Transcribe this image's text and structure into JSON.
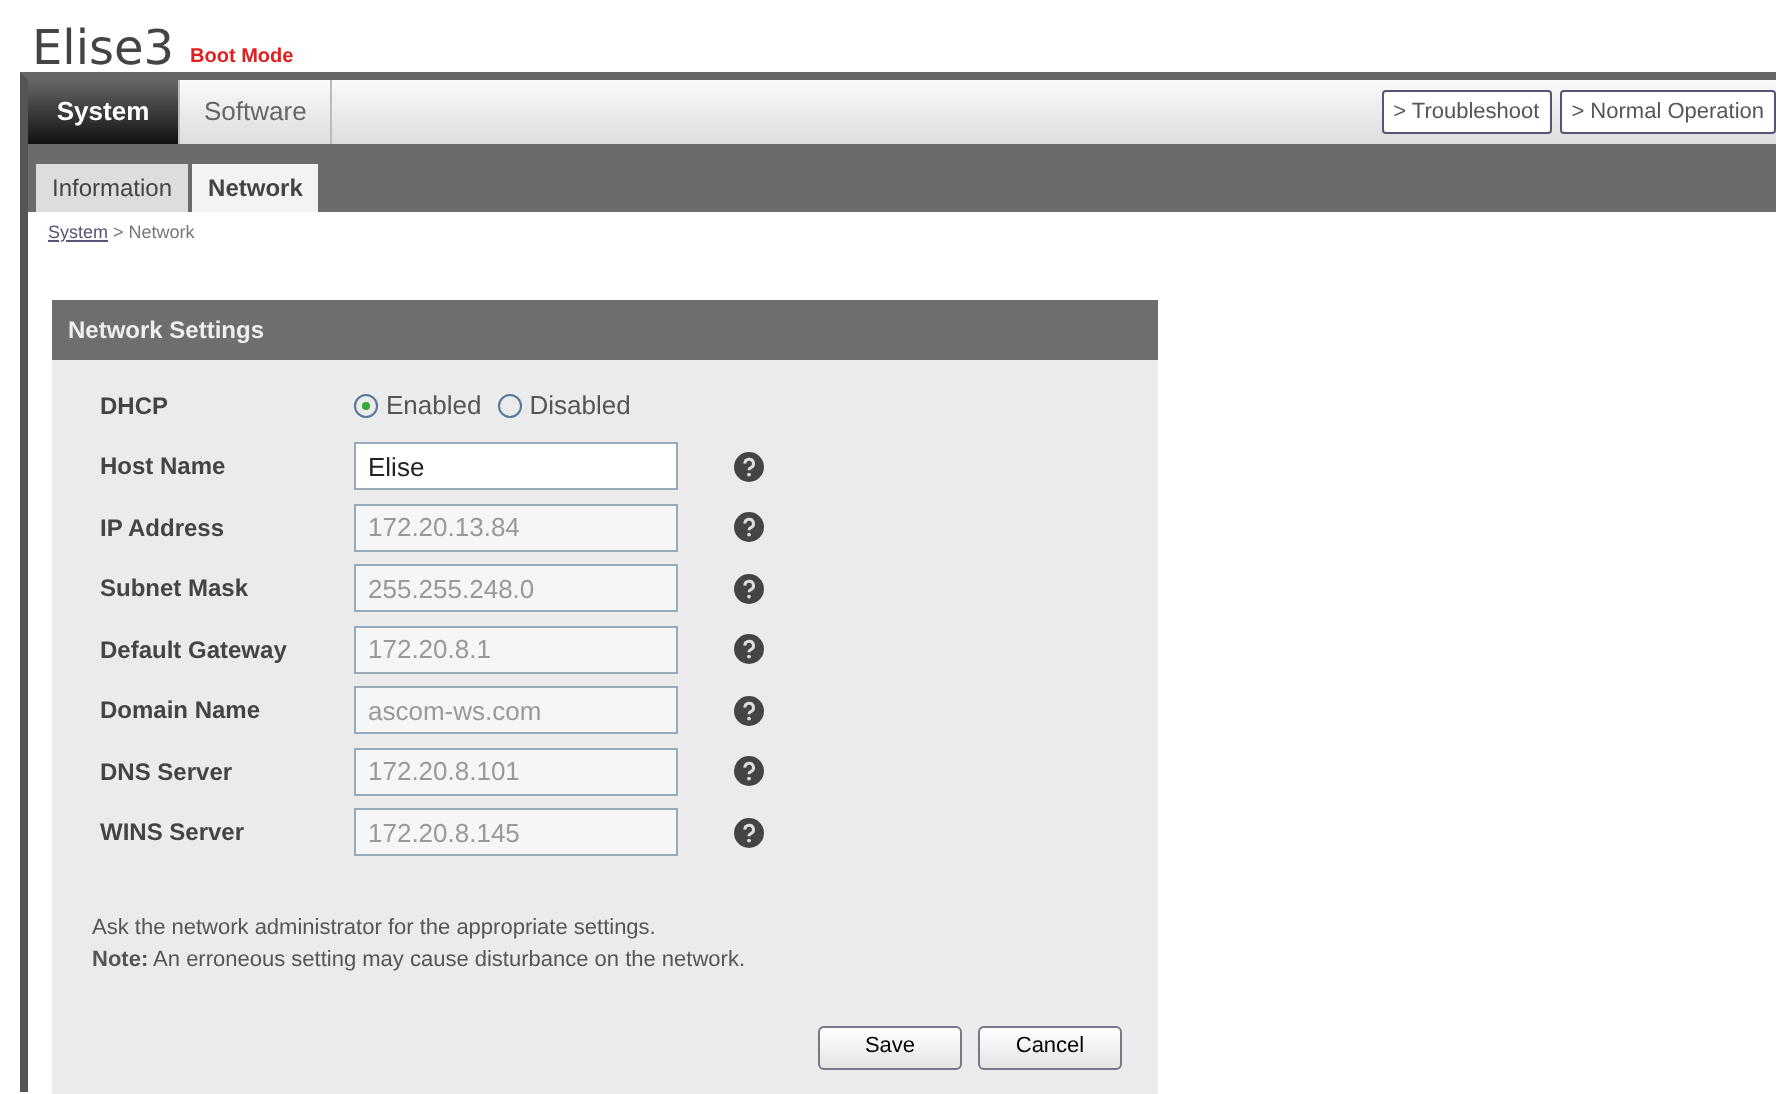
{
  "header": {
    "title": "Elise3",
    "mode": "Boot Mode"
  },
  "main_tabs": [
    {
      "label": "System",
      "selected": true
    },
    {
      "label": "Software",
      "selected": false
    }
  ],
  "actions": [
    "> Troubleshoot",
    "> Normal Operation"
  ],
  "sub_tabs": [
    {
      "label": "Information",
      "selected": false
    },
    {
      "label": "Network",
      "selected": true
    }
  ],
  "breadcrumb": {
    "link": "System",
    "rest": " > Network"
  },
  "panel": {
    "title": "Network Settings",
    "dhcp": {
      "label": "DHCP",
      "options": [
        {
          "label": "Enabled",
          "selected": true
        },
        {
          "label": "Disabled",
          "selected": false
        }
      ]
    },
    "fields": [
      {
        "label": "Host Name",
        "value": "Elise",
        "disabled": false
      },
      {
        "label": "IP Address",
        "value": "172.20.13.84",
        "disabled": true
      },
      {
        "label": "Subnet Mask",
        "value": "255.255.248.0",
        "disabled": true
      },
      {
        "label": "Default Gateway",
        "value": "172.20.8.1",
        "disabled": true
      },
      {
        "label": "Domain Name",
        "value": "ascom-ws.com",
        "disabled": true
      },
      {
        "label": "DNS Server",
        "value": "172.20.8.101",
        "disabled": true
      },
      {
        "label": "WINS Server",
        "value": "172.20.8.145",
        "disabled": true
      }
    ],
    "notes": [
      "Ask the network administrator for the appropriate settings.",
      "**Note:** An erroneous setting may cause disturbance on the network."
    ],
    "buttons": [
      "Save",
      "Cancel"
    ]
  }
}
